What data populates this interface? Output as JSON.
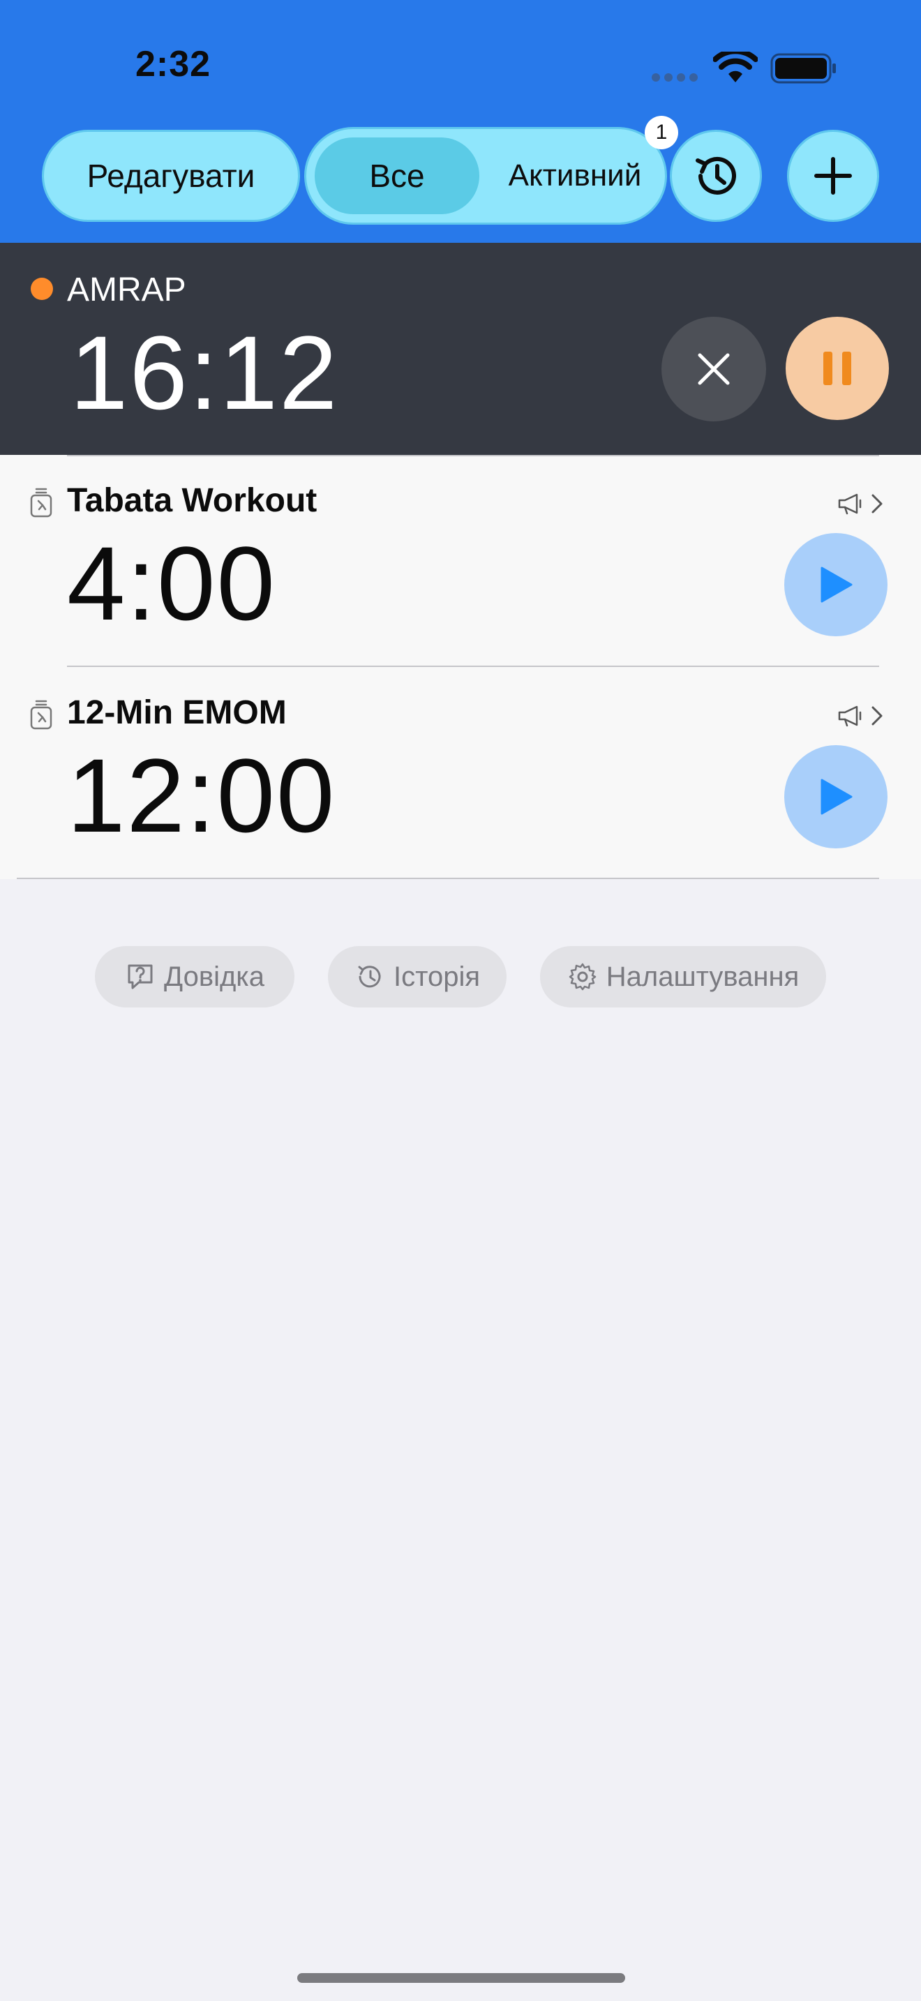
{
  "status_bar": {
    "time": "2:32"
  },
  "toolbar": {
    "edit_label": "Редагувати",
    "segments": [
      {
        "label": "Все",
        "selected": true
      },
      {
        "label": "Активний",
        "selected": false
      }
    ],
    "active_badge": "1"
  },
  "active_timer": {
    "name": "AMRAP",
    "time": "16:12",
    "indicator_color": "#FF8C2B"
  },
  "timers": [
    {
      "name": "Tabata Workout",
      "time": "4:00"
    },
    {
      "name": "12-Min EMOM",
      "time": "12:00"
    }
  ],
  "footer": {
    "help_label": "Довідка",
    "history_label": "Історія",
    "settings_label": "Налаштування"
  },
  "colors": {
    "header": "#2879EA",
    "accent_cyan": "#8FE6FC",
    "play_blue": "#1E8FFF",
    "pause_orange": "#F08A1E"
  }
}
